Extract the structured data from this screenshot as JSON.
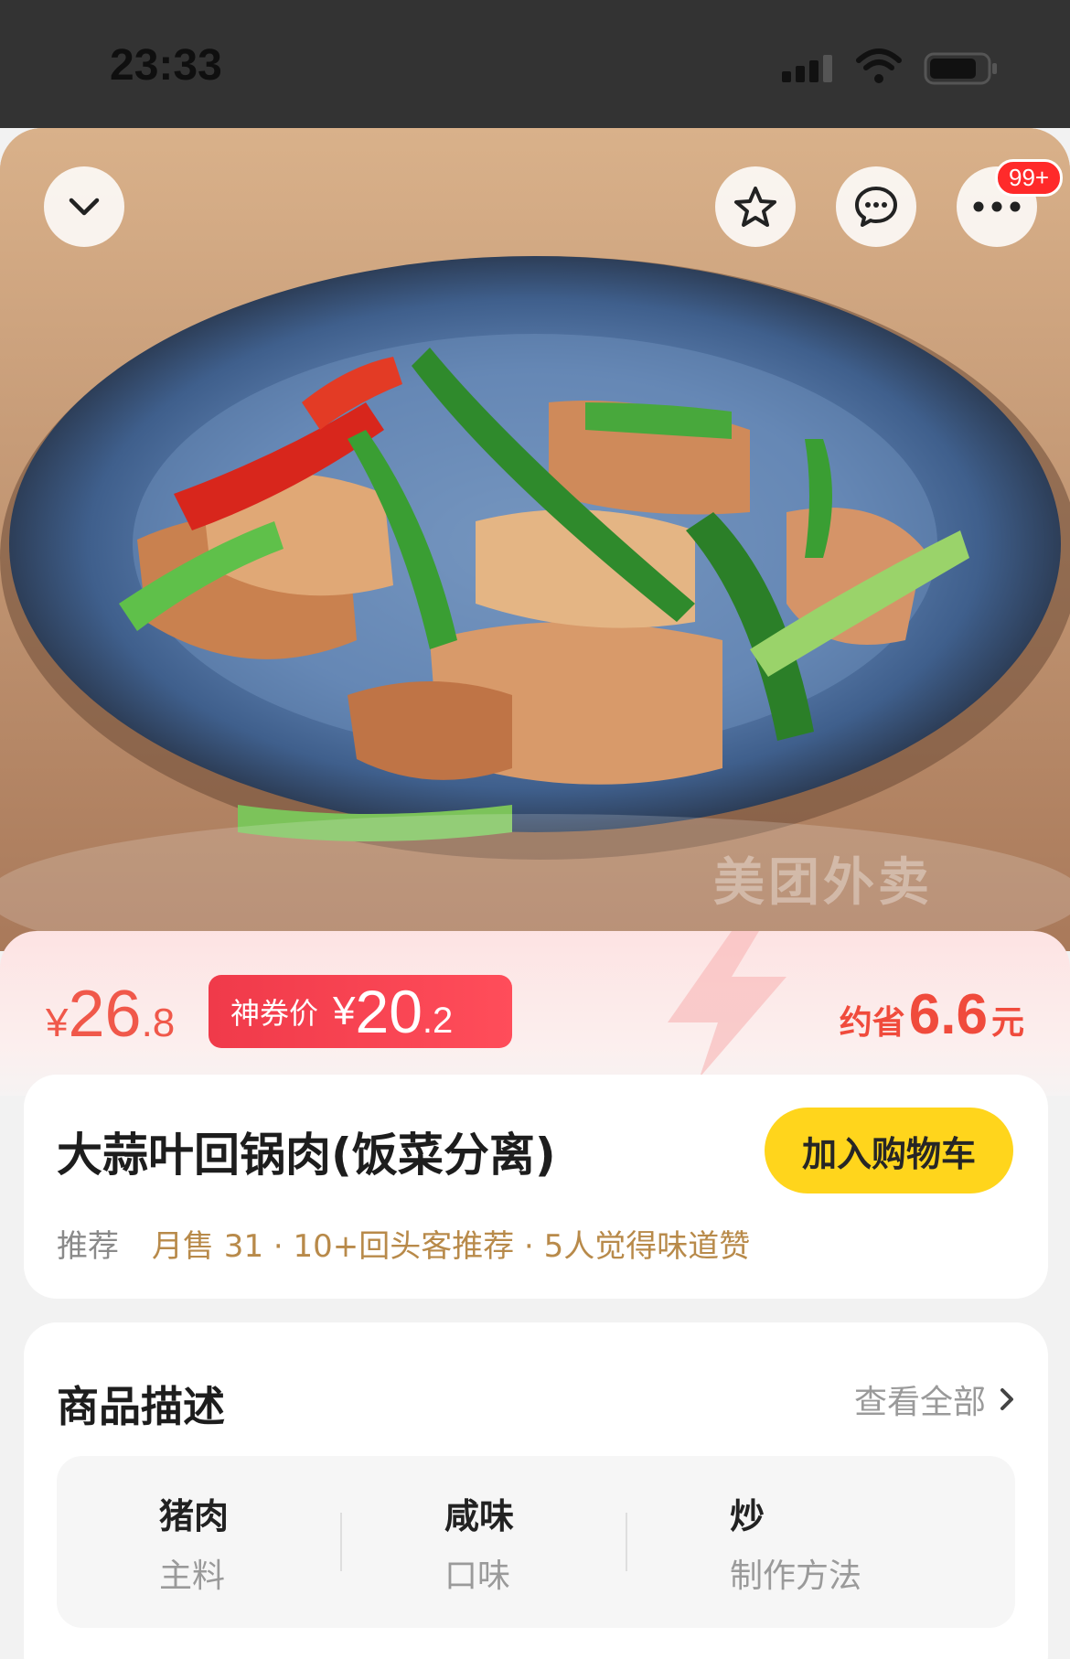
{
  "status_bar": {
    "time": "23:33"
  },
  "hero": {
    "icons": [
      "chevron-down-icon",
      "star-icon",
      "chat-icon",
      "more-icon"
    ],
    "badge": "99+",
    "watermark": "美团外卖"
  },
  "price": {
    "original": {
      "currency": "¥",
      "integer": "26",
      "decimal": ".8"
    },
    "coupon": {
      "label": "神券价",
      "currency": "¥",
      "integer": "20",
      "decimal": ".2"
    },
    "save": {
      "label": "约省",
      "value": "6.6",
      "unit": "元"
    }
  },
  "dish": {
    "name": "大蒜叶回锅肉(饭菜分离)",
    "add_to_cart": "加入购物车",
    "tag": "推荐",
    "stats": "月售 31 · 10+回头客推荐 · 5人觉得味道赞"
  },
  "description": {
    "title": "商品描述",
    "view_all": "查看全部",
    "attributes": [
      {
        "value": "猪肉",
        "key": "主料"
      },
      {
        "value": "咸味",
        "key": "口味"
      },
      {
        "value": "炒",
        "key": "制作方法"
      }
    ]
  },
  "colors": {
    "accent_red": "#f0584a",
    "coupon_red": "#f03a4a",
    "cart_yellow": "#ffd51c",
    "stats_brown": "#b88a4a"
  }
}
